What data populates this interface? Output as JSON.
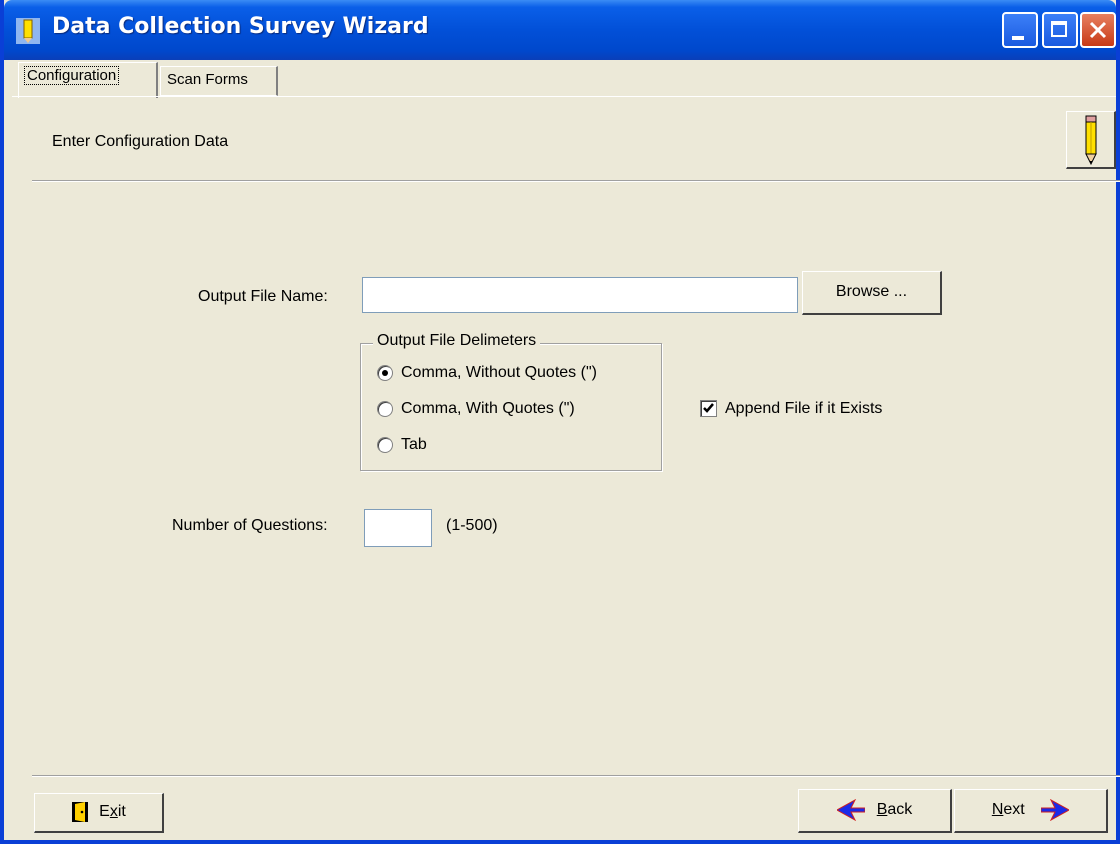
{
  "window": {
    "title": "Data Collection Survey Wizard"
  },
  "tabs": [
    {
      "label": "Configuration",
      "active": true
    },
    {
      "label": "Scan Forms",
      "active": false
    }
  ],
  "header": {
    "text": "Enter Configuration Data"
  },
  "form": {
    "output_label": "Output File Name:",
    "output_value": "",
    "browse_label": "Browse ...",
    "delimiters": {
      "legend": "Output File Delimeters",
      "options": [
        {
          "label": "Comma, Without Quotes (\")",
          "selected": true
        },
        {
          "label": "Comma, With Quotes (\")",
          "selected": false
        },
        {
          "label": "Tab",
          "selected": false
        }
      ]
    },
    "append_label": "Append File if it Exists",
    "append_checked": true,
    "questions_label": "Number of Questions:",
    "questions_value": "",
    "questions_range": "(1-500)"
  },
  "footer": {
    "exit": {
      "prefix": "E",
      "accel": "x",
      "suffix": "it"
    },
    "back": {
      "prefix": "",
      "accel": "B",
      "suffix": "ack"
    },
    "next": {
      "prefix": "",
      "accel": "N",
      "suffix": "ext"
    }
  },
  "colors": {
    "titlebar": "#0250d8",
    "face": "#ece9d8",
    "arrow_blue": "#1a2ae8",
    "arrow_red": "#d02020"
  }
}
